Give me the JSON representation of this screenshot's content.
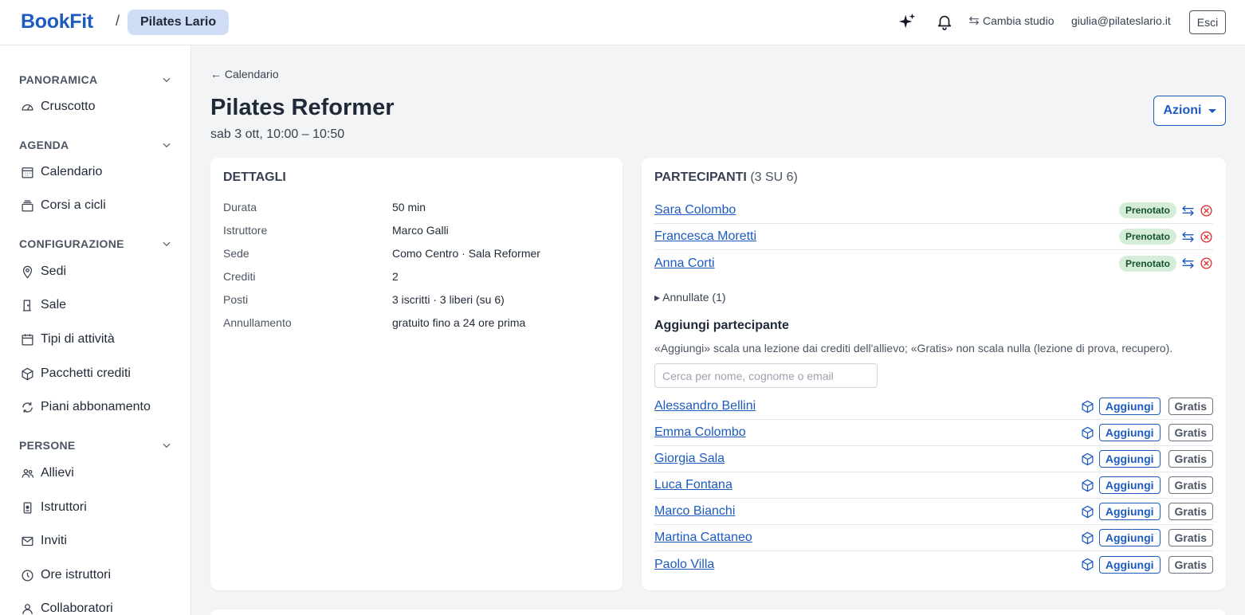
{
  "topbar": {
    "logo": "BookFit",
    "separator": "/",
    "studio": "Pilates Lario",
    "switch_studio": "Cambia studio",
    "user_email": "giulia@pilateslario.it",
    "logout": "Esci"
  },
  "sidebar": {
    "sections": [
      {
        "label": "PANORAMICA",
        "items": [
          {
            "label": "Cruscotto",
            "icon": "gauge-icon"
          }
        ]
      },
      {
        "label": "AGENDA",
        "items": [
          {
            "label": "Calendario",
            "icon": "calendar-grid-icon"
          },
          {
            "label": "Corsi a cicli",
            "icon": "stack-icon"
          }
        ]
      },
      {
        "label": "CONFIGURAZIONE",
        "items": [
          {
            "label": "Sedi",
            "icon": "map-pin-icon"
          },
          {
            "label": "Sale",
            "icon": "door-icon"
          },
          {
            "label": "Tipi di attività",
            "icon": "calendar-icon"
          },
          {
            "label": "Pacchetti crediti",
            "icon": "package-icon"
          },
          {
            "label": "Piani abbonamento",
            "icon": "refresh-icon"
          }
        ]
      },
      {
        "label": "PERSONE",
        "items": [
          {
            "label": "Allievi",
            "icon": "users-icon"
          },
          {
            "label": "Istruttori",
            "icon": "id-badge-icon"
          },
          {
            "label": "Inviti",
            "icon": "envelope-icon"
          },
          {
            "label": "Ore istruttori",
            "icon": "clock-icon"
          },
          {
            "label": "Collaboratori",
            "icon": "user-icon"
          }
        ]
      }
    ]
  },
  "main": {
    "back_link": "← Calendario",
    "title": "Pilates Reformer",
    "subtitle": "sab 3 ott, 10:00 – 10:50",
    "actions": "Azioni"
  },
  "details": {
    "title": "DETTAGLI",
    "rows": [
      {
        "label": "Durata",
        "value": "50 min"
      },
      {
        "label": "Istruttore",
        "value": "Marco Galli"
      },
      {
        "label": "Sede",
        "value": "Como Centro · Sala Reformer"
      },
      {
        "label": "Crediti",
        "value": "2"
      },
      {
        "label": "Posti",
        "value": "3 iscritti · 3 liberi (su 6)"
      },
      {
        "label": "Annullamento",
        "value": "gratuito fino a 24 ore prima"
      }
    ]
  },
  "participants": {
    "title": "PARTECIPANTI",
    "count": "(3 SU 6)",
    "booked": [
      {
        "name": "Sara Colombo",
        "status": "Prenotato"
      },
      {
        "name": "Francesca Moretti",
        "status": "Prenotato"
      },
      {
        "name": "Anna Corti",
        "status": "Prenotato"
      }
    ],
    "cancelled_toggle": "▸ Annullate (1)",
    "add_title": "Aggiungi partecipante",
    "add_help": "«Aggiungi» scala una lezione dai crediti dell'allievo; «Gratis» non scala nulla (lezione di prova, recupero).",
    "search_placeholder": "Cerca per nome, cognome o email",
    "add_label": "Aggiungi",
    "free_label": "Gratis",
    "candidates": [
      {
        "name": "Alessandro Bellini"
      },
      {
        "name": "Emma Colombo"
      },
      {
        "name": "Giorgia Sala"
      },
      {
        "name": "Luca Fontana"
      },
      {
        "name": "Marco Bianchi"
      },
      {
        "name": "Martina Cattaneo"
      },
      {
        "name": "Paolo Villa"
      }
    ]
  },
  "colors": {
    "brand": "#1d5bbf",
    "badge_bg": "#d5ecd8",
    "danger": "#dc2626"
  }
}
